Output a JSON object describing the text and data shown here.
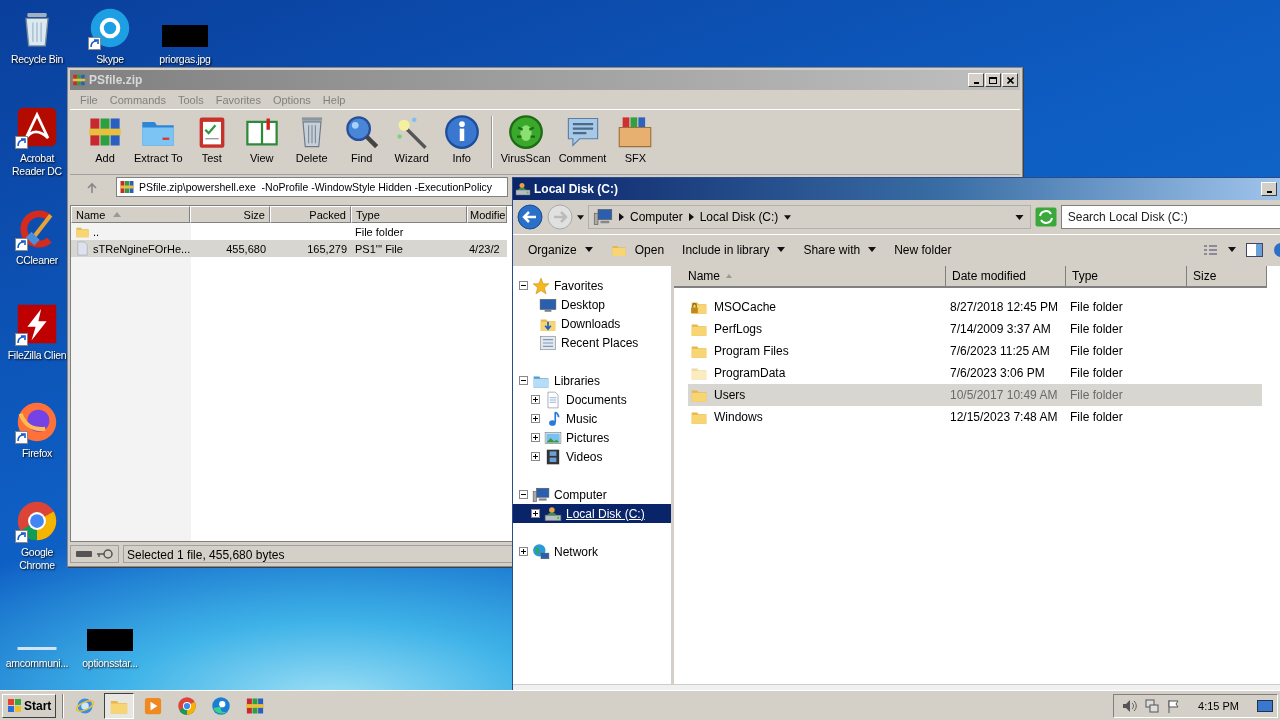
{
  "desktop": {
    "icons": [
      {
        "label": "Recycle Bin",
        "kind": "recycle",
        "shortcut": false
      },
      {
        "label": "Skype",
        "kind": "skype",
        "shortcut": true
      },
      {
        "label": "priorgas.jpg",
        "kind": "redacted",
        "shortcut": false
      },
      {
        "label": "Acrobat Reader DC",
        "kind": "acrobat",
        "shortcut": true
      },
      {
        "label": "CCleaner",
        "kind": "ccleaner",
        "shortcut": true
      },
      {
        "label": "FileZilla Clien",
        "kind": "filezilla",
        "shortcut": true
      },
      {
        "label": "Firefox",
        "kind": "firefox",
        "shortcut": true
      },
      {
        "label": "Google Chrome",
        "kind": "chrome",
        "shortcut": true
      },
      {
        "label": "amcommuni...",
        "kind": "blank",
        "shortcut": false
      },
      {
        "label": "optionsstar...",
        "kind": "redacted",
        "shortcut": false
      }
    ]
  },
  "winrar": {
    "title": "PSfile.zip",
    "menu": [
      "File",
      "Commands",
      "Tools",
      "Favorites",
      "Options",
      "Help"
    ],
    "toolbar": [
      {
        "label": "Add",
        "kind": "add"
      },
      {
        "label": "Extract To",
        "kind": "extract"
      },
      {
        "label": "Test",
        "kind": "test"
      },
      {
        "label": "View",
        "kind": "view"
      },
      {
        "label": "Delete",
        "kind": "delete"
      },
      {
        "label": "Find",
        "kind": "find"
      },
      {
        "label": "Wizard",
        "kind": "wizard"
      },
      {
        "label": "Info",
        "kind": "info"
      },
      {
        "label": "VirusScan",
        "kind": "virusscan"
      },
      {
        "label": "Comment",
        "kind": "comment"
      },
      {
        "label": "SFX",
        "kind": "sfx"
      }
    ],
    "address": "PSfile.zip\\powershell.exe  -NoProfile -WindowStyle Hidden -ExecutionPolicy",
    "columns": [
      "Name",
      "Size",
      "Packed",
      "Type",
      "Modifie"
    ],
    "rows": [
      {
        "name": "..",
        "size": "",
        "packed": "",
        "type": "File folder",
        "modified": "",
        "kind": "folder",
        "selected": false
      },
      {
        "name": "sTReNgineFOrHe...",
        "size": "455,680",
        "packed": "165,279",
        "type": "PS1''' File",
        "modified": "4/23/2",
        "kind": "file",
        "selected": true
      }
    ],
    "status": "Selected 1 file, 455,680 bytes"
  },
  "explorer": {
    "title": "Local Disk (C:)",
    "breadcrumb": [
      "Computer",
      "Local Disk (C:)"
    ],
    "search": {
      "placeholder": "Search Local Disk (C:)"
    },
    "commands": [
      {
        "label": "Organize",
        "kind": "menu"
      },
      {
        "label": "Open",
        "kind": "icon"
      },
      {
        "label": "Include in library",
        "kind": "menu"
      },
      {
        "label": "Share with",
        "kind": "menu"
      },
      {
        "label": "New folder",
        "kind": "plain"
      }
    ],
    "nav": [
      {
        "label": "Favorites",
        "kind": "star",
        "expanded": true,
        "selected": false,
        "children": [
          {
            "label": "Desktop",
            "kind": "desktop",
            "selected": false
          },
          {
            "label": "Downloads",
            "kind": "downloads",
            "selected": false
          },
          {
            "label": "Recent Places",
            "kind": "recent",
            "selected": false
          }
        ]
      },
      {
        "label": "Libraries",
        "kind": "libraries",
        "expanded": true,
        "selected": false,
        "children": [
          {
            "label": "Documents",
            "kind": "documents",
            "expanded": false,
            "selected": false
          },
          {
            "label": "Music",
            "kind": "music",
            "expanded": false,
            "selected": false
          },
          {
            "label": "Pictures",
            "kind": "pictures",
            "expanded": false,
            "selected": false
          },
          {
            "label": "Videos",
            "kind": "videos",
            "expanded": false,
            "selected": false
          }
        ]
      },
      {
        "label": "Computer",
        "kind": "computer",
        "expanded": true,
        "selected": false,
        "children": [
          {
            "label": "Local Disk (C:)",
            "kind": "drive",
            "expanded": false,
            "selected": true
          }
        ]
      },
      {
        "label": "Network",
        "kind": "network",
        "expanded": false,
        "selected": false
      }
    ],
    "columns": [
      "Name",
      "Date modified",
      "Type",
      "Size"
    ],
    "rows": [
      {
        "name": "MSOCache",
        "date": "8/27/2018 12:45 PM",
        "type": "File folder",
        "kind": "locked",
        "selected": false
      },
      {
        "name": "PerfLogs",
        "date": "7/14/2009 3:37 AM",
        "type": "File folder",
        "kind": "folder",
        "selected": false
      },
      {
        "name": "Program Files",
        "date": "7/6/2023 11:25 AM",
        "type": "File folder",
        "kind": "folder",
        "selected": false
      },
      {
        "name": "ProgramData",
        "date": "7/6/2023 3:06 PM",
        "type": "File folder",
        "kind": "faded",
        "selected": false
      },
      {
        "name": "Users",
        "date": "10/5/2017 10:49 AM",
        "type": "File folder",
        "kind": "folder",
        "selected": true
      },
      {
        "name": "Windows",
        "date": "12/15/2023 7:48 AM",
        "type": "File folder",
        "kind": "folder",
        "selected": false
      }
    ]
  },
  "taskbar": {
    "start": "Start",
    "apps": [
      {
        "kind": "ie",
        "active": false
      },
      {
        "kind": "explorer",
        "active": true
      },
      {
        "kind": "media",
        "active": false
      },
      {
        "kind": "chrome",
        "active": false
      },
      {
        "kind": "edge",
        "active": false
      },
      {
        "kind": "winrar",
        "active": false
      }
    ],
    "clock": "4:15 PM"
  }
}
